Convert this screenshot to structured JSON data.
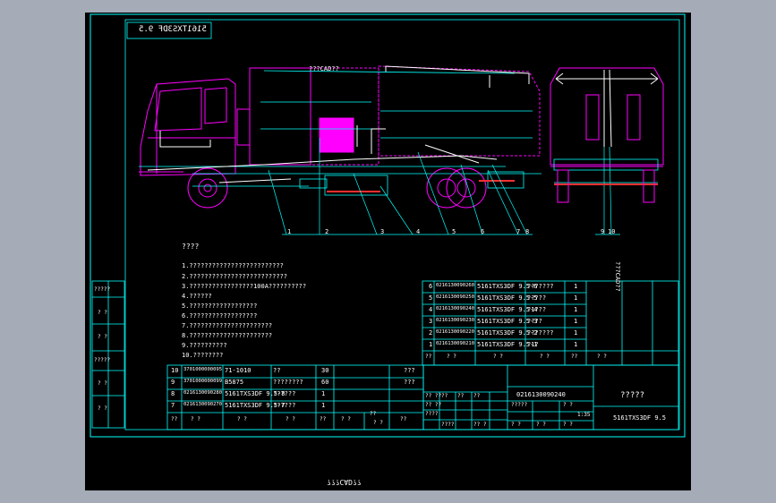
{
  "title_box_mirrored": "5161TXS3DF 9.5",
  "mid_label": "???CAD??",
  "bottom_mirrored": "???CAD??",
  "right_side_label": "???CAD??",
  "callouts": [
    "1",
    "2",
    "3",
    "4",
    "5",
    "6",
    "7",
    "8",
    "9",
    "10"
  ],
  "notes": {
    "heading": "????",
    "items": [
      "1.?????????????????????????",
      "2.??????????????????????????",
      "3.?????????????????100A??????????",
      "4.??????",
      "5.??????????????????",
      "6.??????????????????",
      "7.??????????????????????",
      "8.??????????????????????",
      "9.??????????",
      "10.????????"
    ]
  },
  "left_margin": [
    "?????",
    "? ?",
    "? ?",
    "?????",
    "? ?",
    "? ?"
  ],
  "bom_upper": [
    {
      "no": "6",
      "code": "0216130090260",
      "name": "5161TXS3DF 9.5-6",
      "desc": "???????",
      "qty": "1"
    },
    {
      "no": "5",
      "code": "0216130090250",
      "name": "5161TXS3DF 9.5-5",
      "desc": "?????",
      "qty": "1"
    },
    {
      "no": "4",
      "code": "0216130090240",
      "name": "5161TXS3DF 9.5-4",
      "desc": "?1???",
      "qty": "1"
    },
    {
      "no": "3",
      "code": "0216130090230",
      "name": "5161TXS3DF 9.5-3",
      "desc": "????",
      "qty": "1"
    },
    {
      "no": "2",
      "code": "0216130090220",
      "name": "5161TXS3DF 9.5-2",
      "desc": "???????",
      "qty": "1"
    },
    {
      "no": "1",
      "code": "0216130090210",
      "name": "5161TXS3DF 9.5-1",
      "desc": "?1?",
      "qty": "1"
    }
  ],
  "bom_upper_header": [
    "??",
    "?  ?",
    "?  ?",
    "?  ?",
    "??",
    "?  ?"
  ],
  "bom_lower": [
    {
      "no": "10",
      "code": "3701000000095",
      "name": "71-1010",
      "desc": "??",
      "qty": "30",
      "note": "???"
    },
    {
      "no": "9",
      "code": "3701000000099",
      "name": "B5875",
      "desc": "????????",
      "qty": "60",
      "note": "???"
    },
    {
      "no": "8",
      "code": "0216130090280",
      "name": "5161TXS3DF 9.5-8",
      "desc": "??????",
      "qty": "1",
      "note": ""
    },
    {
      "no": "7",
      "code": "0216130090270",
      "name": "5161TXS3DF 9.5-7",
      "desc": "??????",
      "qty": "1",
      "note": ""
    }
  ],
  "bom_lower_header": [
    "??",
    "?  ?",
    "?  ?",
    "?  ?",
    "??",
    "?  ?",
    "??",
    "?  ?",
    "??"
  ],
  "title_block": {
    "drawing_no": "0216130090240",
    "drawing_title": "?????",
    "model": "5161TXS3DF 9.5",
    "scale": "1:35",
    "cells": [
      "?? ??",
      "?? ??",
      "????",
      "??",
      "??",
      "??",
      "????",
      "?? ?",
      "?????",
      "? ?",
      "? ?",
      "?  ?",
      "?  ?"
    ]
  },
  "colors": {
    "outline": "#00ffff",
    "magenta": "#ff00ff",
    "white": "#ffffff",
    "background": "#000000",
    "page": "#a5acb8"
  }
}
